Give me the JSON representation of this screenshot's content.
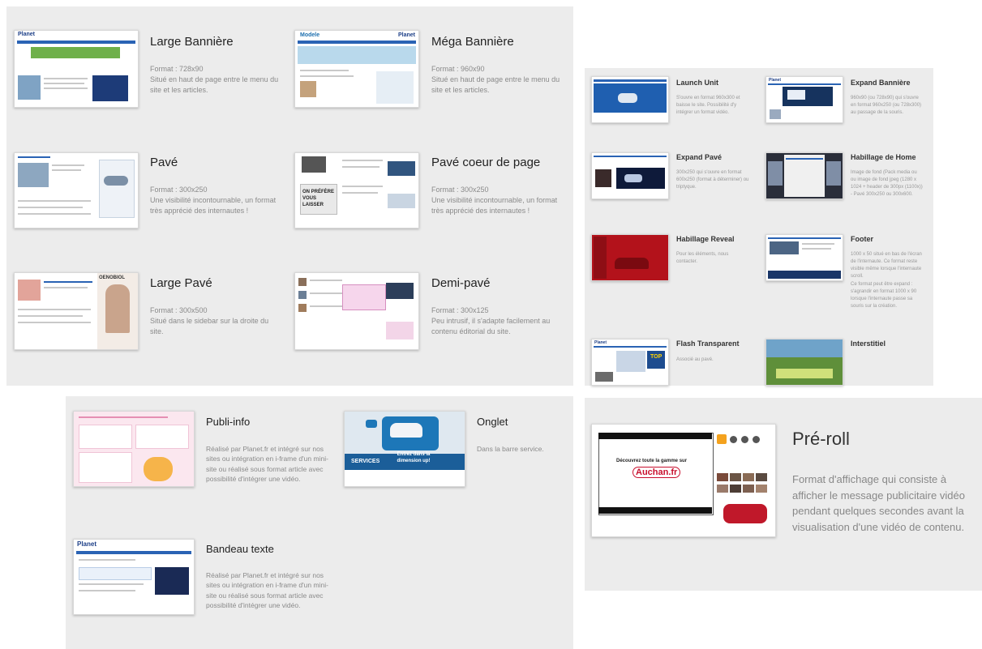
{
  "panels": {
    "top_left": [
      {
        "title": "Large Bannière",
        "lines": [
          "Format : 728x90",
          "Situé en haut de page entre le menu du site et les articles."
        ],
        "thumb": "large-banniere-thumbnail"
      },
      {
        "title": "Méga Bannière",
        "lines": [
          "Format : 960x90",
          "Situé en haut de page entre le menu du site et les articles."
        ],
        "thumb": "mega-banniere-thumbnail"
      },
      {
        "title": "Pavé",
        "lines": [
          "Format : 300x250",
          "Une visibilité incontournable, un format très apprécié des internautes !"
        ],
        "thumb": "pave-thumbnail"
      },
      {
        "title": "Pavé coeur de page",
        "lines": [
          "Format : 300x250",
          "Une visibilité incontournable, un format très apprécié des internautes !"
        ],
        "thumb": "pave-coeur-thumbnail"
      },
      {
        "title": "Large Pavé",
        "lines": [
          "Format : 300x500",
          "Situé dans le sidebar sur la droite du site."
        ],
        "thumb": "large-pave-thumbnail"
      },
      {
        "title": "Demi-pavé",
        "lines": [
          "Format : 300x125",
          "Peu intrusif, il s'adapte facilement au contenu éditorial du site."
        ],
        "thumb": "demi-pave-thumbnail"
      }
    ],
    "right": [
      {
        "title": "Launch Unit",
        "desc": "S'ouvre en format 960x300 et baisse le site. Possibilité d'y intégrer un format vidéo."
      },
      {
        "title": "Expand Bannière",
        "desc": "960x90 (ou 728x90) qui s'ouvre en format 960x250 (ou 728x300) au passage de la souris."
      },
      {
        "title": "Expand Pavé",
        "desc": "300x250 qui s'ouvre en format 600x250 (format à déterminer) ou triptyque."
      },
      {
        "title": "Habillage de Home",
        "desc": "Image de fond (Pack media ou ou image de fond jpeg (1280 x 1024 + header de 300px (1100x)) - Pavé 300x250 ou 300x600."
      },
      {
        "title": "Habillage Reveal",
        "desc": "Pour les éléments, nous contacter."
      },
      {
        "title": "Footer",
        "desc": "1000 x 50 situé en bas de l'écran de l'internaute. Ce format reste visible même lorsque l'internaute scroll.",
        "desc2": "Ce format peut être expand : s'agrandir en format 1000 x 90 lorsque l'internaute passe sa souris sur la création."
      },
      {
        "title": "Flash Transparent",
        "desc": "Associé au pavé."
      },
      {
        "title": "Interstitiel",
        "desc": ""
      }
    ],
    "bottom_left": [
      {
        "title": "Publi-info",
        "desc": "Réalisé par Planet.fr et intégré sur nos sites ou intégration en i-frame d'un mini-site ou réalisé sous format article avec possibilité d'intégrer une vidéo."
      },
      {
        "title": "Onglet",
        "desc": "Dans la barre service."
      },
      {
        "title": "Bandeau texte",
        "desc": "Réalisé par Planet.fr et intégré sur nos sites ou intégration en i-frame d'un mini-site ou réalisé sous format article avec possibilité d'intégrer une vidéo."
      }
    ],
    "preroll": {
      "title": "Pré-roll",
      "desc": "Format d'affichage qui consiste à afficher le message publicitaire vidéo pendant quelques secondes avant la visualisation d'une vidéo de contenu.",
      "video_caption": "Découvrez toute la gamme sur",
      "brand": "Auchan.fr"
    }
  },
  "thumb_text": {
    "planet": "Planet",
    "modele": "Modele",
    "on_prefere": "ON PRÉFÈRE VOUS LAISSER",
    "services": "SERVICES",
    "onglet_cta": "Entrez dans la dimension up!",
    "oenobiol": "OENOBIOL",
    "top": "TOP"
  },
  "colors": {
    "panel_bg": "#ececec",
    "nav_blue": "#2a63b4",
    "title": "#222222",
    "desc": "#8a8a8a",
    "accent_red": "#c8102e"
  }
}
